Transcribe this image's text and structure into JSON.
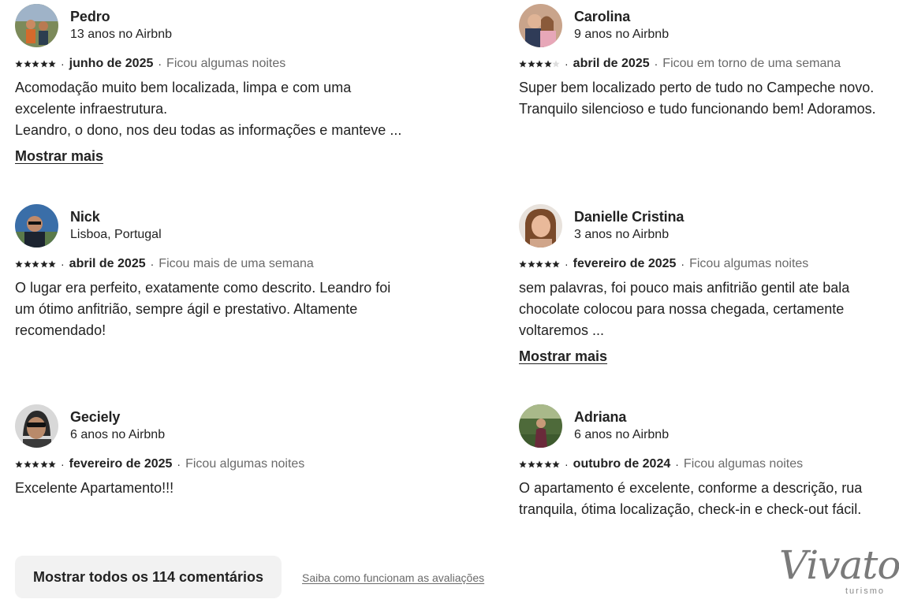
{
  "reviews": [
    {
      "name": "Pedro",
      "subtitle": "13 anos no Airbnb",
      "rating": 5,
      "date": "junho de 2025",
      "stay": "Ficou algumas noites",
      "text": "Acomodação muito bem localizada, limpa e com uma\nexcelente infraestrutura.\nLeandro, o dono, nos deu todas as informações e manteve ...",
      "show_more": "Mostrar mais"
    },
    {
      "name": "Carolina",
      "subtitle": "9 anos no Airbnb",
      "rating": 4,
      "date": "abril de 2025",
      "stay": "Ficou em torno de uma semana",
      "text": "Super bem localizado perto de tudo no Campeche novo.\nTranquilo silencioso e tudo funcionando bem! Adoramos.",
      "show_more": ""
    },
    {
      "name": "Nick",
      "subtitle": "Lisboa, Portugal",
      "rating": 5,
      "date": "abril de 2025",
      "stay": "Ficou mais de uma semana",
      "text": "O lugar era perfeito, exatamente como descrito. Leandro foi\num ótimo anfitrião, sempre ágil e prestativo. Altamente\nrecomendado!",
      "show_more": ""
    },
    {
      "name": "Danielle Cristina",
      "subtitle": "3 anos no Airbnb",
      "rating": 5,
      "date": "fevereiro de 2025",
      "stay": "Ficou algumas noites",
      "text": "sem palavras, foi pouco mais anfitrião  gentil ate bala\nchocolate colocou para nossa chegada,  certamente\nvoltaremos ...",
      "show_more": "Mostrar mais"
    },
    {
      "name": "Geciely",
      "subtitle": "6 anos no Airbnb",
      "rating": 5,
      "date": "fevereiro de 2025",
      "stay": "Ficou algumas noites",
      "text": "Excelente Apartamento!!!",
      "show_more": ""
    },
    {
      "name": "Adriana",
      "subtitle": "6 anos no Airbnb",
      "rating": 5,
      "date": "outubro de 2024",
      "stay": "Ficou algumas noites",
      "text": "O apartamento  é excelente, conforme a descrição, rua\ntranquila, ótima localização, check-in e check-out fácil.",
      "show_more": ""
    }
  ],
  "separator": "·",
  "footer": {
    "show_all_button": "Mostrar todos os 114 comentários",
    "how_reviews_work_link": "Saiba como funcionam as avaliações"
  },
  "watermark": {
    "brand": "Vivato",
    "tagline": "turismo"
  },
  "colors": {
    "text": "#222222",
    "muted": "#6a6a6a",
    "star_filled": "#222222",
    "star_empty": "#dddddd",
    "button_bg": "#f2f2f2"
  },
  "icons": {
    "star": "star-icon",
    "avatar": "avatar-photo"
  }
}
